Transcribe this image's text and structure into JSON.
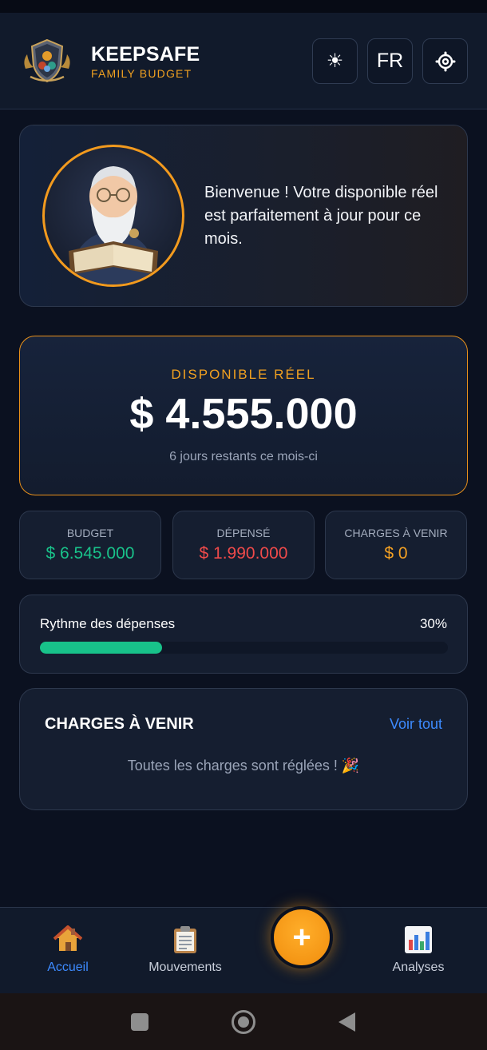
{
  "header": {
    "brand_title": "KEEPSAFE",
    "brand_subtitle": "FAMILY BUDGET",
    "theme_icon": "sun-icon",
    "theme_glyph": "☀",
    "language": "FR",
    "settings_icon": "gear-icon",
    "settings_glyph": "⚙"
  },
  "welcome": {
    "message": "Bienvenue ! Votre disponible réel est parfaitement à jour pour ce mois."
  },
  "available": {
    "label": "DISPONIBLE RÉEL",
    "amount": "$ 4.555.000",
    "days_left": "6 jours restants ce mois-ci"
  },
  "stats": [
    {
      "label": "BUDGET",
      "value": "$ 6.545.000",
      "color": "#19c28a"
    },
    {
      "label": "DÉPENSÉ",
      "value": "$ 1.990.000",
      "color": "#ef4a4a"
    },
    {
      "label": "CHARGES À VENIR",
      "value": "$ 0",
      "color": "#f3a023"
    }
  ],
  "rhythm": {
    "label": "Rythme des dépenses",
    "percent_label": "30%",
    "progress": 0.3
  },
  "charges": {
    "title": "CHARGES À VENIR",
    "see_all": "Voir tout",
    "empty_message": "Toutes les charges sont réglées ! 🎉"
  },
  "bottom_nav": {
    "items": [
      {
        "label": "Accueil",
        "icon": "house-icon",
        "active": true
      },
      {
        "label": "Mouvements",
        "icon": "clipboard-icon",
        "active": false
      },
      {
        "label": "Analyses",
        "icon": "bar-chart-icon",
        "active": false
      }
    ],
    "fab_glyph": "+"
  },
  "colors": {
    "accent": "#f0a020",
    "active_nav": "#3d8bff",
    "background": "#0b1120"
  }
}
